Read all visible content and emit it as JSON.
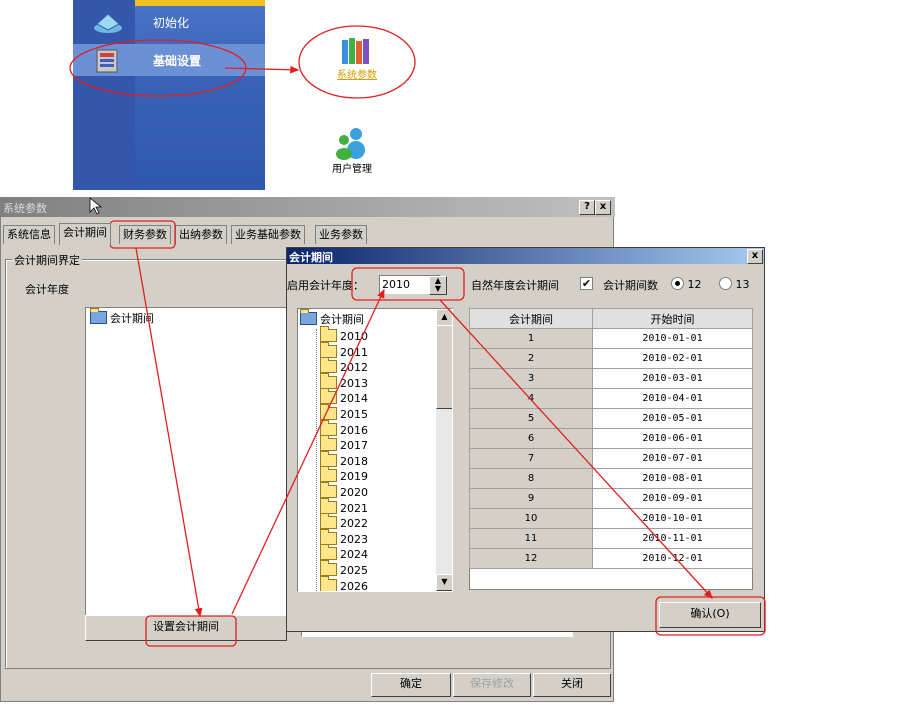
{
  "launcher": {
    "item_init": "初始化",
    "item_basic": "基础设置",
    "icon_sysparams": "系统参数",
    "icon_users": "用户管理"
  },
  "sys_dialog": {
    "title": "系统参数",
    "help_btn": "?",
    "close_btn": "x",
    "tabs": [
      "系统信息",
      "会计期间",
      "财务参数",
      "出纳参数",
      "业务基础参数",
      "业务参数"
    ],
    "group_label": "会计期间界定",
    "year_label": "会计年度",
    "tree_root": "会计期间",
    "set_period_btn": "设置会计期间",
    "ok_btn": "确定",
    "save_btn": "保存修改",
    "close_label": "关闭"
  },
  "period_dialog": {
    "title": "会计期间",
    "close_btn": "x",
    "start_year_label": "启用会计年度：",
    "start_year_value": "2010",
    "natural_year_label": "自然年度会计期间",
    "natural_year_checked": true,
    "period_count_label": "会计期间数",
    "period_opt_12": "12",
    "period_opt_13": "13",
    "tree_root": "会计期间",
    "years": [
      "2010",
      "2011",
      "2012",
      "2013",
      "2014",
      "2015",
      "2016",
      "2017",
      "2018",
      "2019",
      "2020",
      "2021",
      "2022",
      "2023",
      "2024",
      "2025",
      "2026"
    ],
    "table_headers": [
      "会计期间",
      "开始时间"
    ],
    "rows": [
      [
        "1",
        "2010-01-01"
      ],
      [
        "2",
        "2010-02-01"
      ],
      [
        "3",
        "2010-03-01"
      ],
      [
        "4",
        "2010-04-01"
      ],
      [
        "5",
        "2010-05-01"
      ],
      [
        "6",
        "2010-06-01"
      ],
      [
        "7",
        "2010-07-01"
      ],
      [
        "8",
        "2010-08-01"
      ],
      [
        "9",
        "2010-09-01"
      ],
      [
        "10",
        "2010-10-01"
      ],
      [
        "11",
        "2010-11-01"
      ],
      [
        "12",
        "2010-12-01"
      ]
    ],
    "confirm_btn": "确认(O)"
  },
  "colors": {
    "annotation": "#e02020",
    "launcher_blue": "#3a63b8",
    "dialog_title": "#0a246a"
  }
}
